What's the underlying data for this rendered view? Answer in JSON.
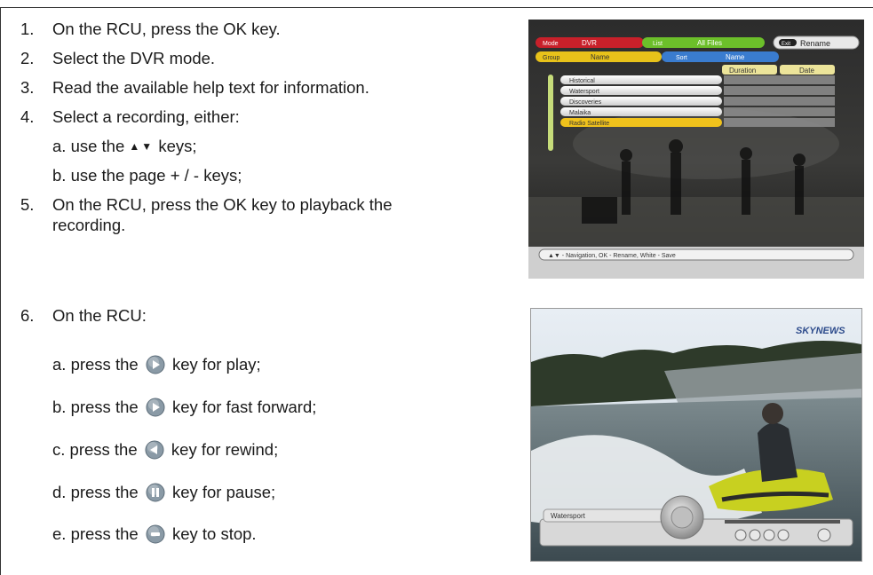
{
  "steps": [
    {
      "num": "1.",
      "text": "On the RCU, press the OK key."
    },
    {
      "num": "2.",
      "text": "Select the DVR mode."
    },
    {
      "num": "3.",
      "text": "Read the available help text for information."
    },
    {
      "num": "4.",
      "text": "Select a recording, either:"
    },
    {
      "num": "5.",
      "line1": "On the RCU, press the OK key to playback the",
      "line2": "recording."
    },
    {
      "num": "6.",
      "text": "On the RCU:"
    }
  ],
  "step4_subs": [
    {
      "pre": "a. use the",
      "post": "keys;"
    },
    {
      "text": "b. use the page + / - keys;"
    }
  ],
  "step6_subs": [
    {
      "pre": "a. press the",
      "post": "key for play;",
      "icon": "play-key-icon"
    },
    {
      "pre": "b. press the",
      "post": "key for fast forward;",
      "icon": "fast-forward-key-icon"
    },
    {
      "pre": "c. press the",
      "post": "key for rewind;",
      "icon": "rewind-key-icon"
    },
    {
      "pre": "d. press the",
      "post": "key for pause;",
      "icon": "pause-key-icon"
    },
    {
      "pre": "e. press the",
      "post": "key to stop.",
      "icon": "stop-key-icon"
    }
  ],
  "screen1": {
    "tab_mode_label": "Mode",
    "tab_mode_value": "DVR",
    "tab_list_label": "List",
    "tab_list_value": "All Files",
    "tab_exit_label": "Exit",
    "tab_exit_value": "Rename",
    "tab_group_label": "Group",
    "tab_group_value": "Name",
    "tab_sort_label": "Sort",
    "tab_sort_value": "Name",
    "col_duration": "Duration",
    "col_date": "Date",
    "recordings": [
      "Historical",
      "Watersport",
      "Discoveries",
      "Malaika",
      "Radio Satellite"
    ],
    "help_bar": "▲▼ - Navigation, OK - Rename, White - Save"
  },
  "screen2": {
    "channel_logo": "SKYNEWS",
    "osd_title": "Watersport"
  },
  "colors": {
    "text": "#1a1a1a",
    "key_icon": "#8a9aa6",
    "tab_red": "#c8202a",
    "tab_green": "#6cbf2a",
    "tab_yellow": "#e8c21a",
    "tab_blue": "#3a7ccf"
  }
}
